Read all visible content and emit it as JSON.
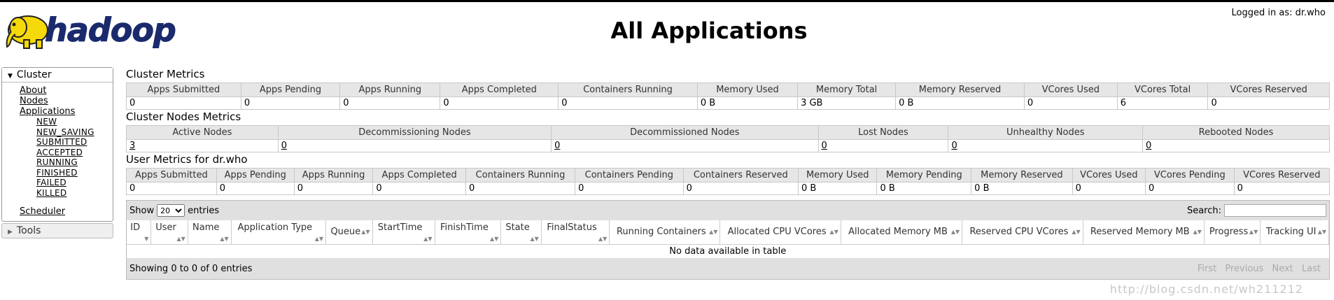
{
  "header": {
    "logo_text": "hadoop",
    "title": "All Applications",
    "logged_in": "Logged in as: dr.who"
  },
  "sidebar": {
    "cluster_label": "Cluster",
    "items": [
      "About",
      "Nodes",
      "Applications"
    ],
    "app_states": [
      "NEW",
      "NEW_SAVING",
      "SUBMITTED",
      "ACCEPTED",
      "RUNNING",
      "FINISHED",
      "FAILED",
      "KILLED"
    ],
    "scheduler": "Scheduler",
    "tools_label": "Tools"
  },
  "cluster_metrics": {
    "title": "Cluster Metrics",
    "headers": [
      "Apps Submitted",
      "Apps Pending",
      "Apps Running",
      "Apps Completed",
      "Containers Running",
      "Memory Used",
      "Memory Total",
      "Memory Reserved",
      "VCores Used",
      "VCores Total",
      "VCores Reserved"
    ],
    "values": [
      "0",
      "0",
      "0",
      "0",
      "0",
      "0 B",
      "3 GB",
      "0 B",
      "0",
      "6",
      "0"
    ]
  },
  "node_metrics": {
    "title": "Cluster Nodes Metrics",
    "headers": [
      "Active Nodes",
      "Decommissioning Nodes",
      "Decommissioned Nodes",
      "Lost Nodes",
      "Unhealthy Nodes",
      "Rebooted Nodes"
    ],
    "values": [
      "3",
      "0",
      "0",
      "0",
      "0",
      "0"
    ]
  },
  "user_metrics": {
    "title": "User Metrics for dr.who",
    "headers": [
      "Apps Submitted",
      "Apps Pending",
      "Apps Running",
      "Apps Completed",
      "Containers Running",
      "Containers Pending",
      "Containers Reserved",
      "Memory Used",
      "Memory Pending",
      "Memory Reserved",
      "VCores Used",
      "VCores Pending",
      "VCores Reserved"
    ],
    "values": [
      "0",
      "0",
      "0",
      "0",
      "0",
      "0",
      "0",
      "0 B",
      "0 B",
      "0 B",
      "0",
      "0",
      "0"
    ]
  },
  "apps_table": {
    "show_label": "Show",
    "page_size": "20",
    "entries_label": "entries",
    "search_label": "Search:",
    "columns": [
      {
        "label": "ID",
        "two": true
      },
      {
        "label": "User",
        "two": true
      },
      {
        "label": "Name",
        "two": true
      },
      {
        "label": "Application Type",
        "two": true
      },
      {
        "label": "Queue",
        "two": false
      },
      {
        "label": "StartTime",
        "two": true
      },
      {
        "label": "FinishTime",
        "two": true
      },
      {
        "label": "State",
        "two": true
      },
      {
        "label": "FinalStatus",
        "two": true
      },
      {
        "label": "Running Containers",
        "two": false
      },
      {
        "label": "Allocated CPU VCores",
        "two": false
      },
      {
        "label": "Allocated Memory MB",
        "two": false
      },
      {
        "label": "Reserved CPU VCores",
        "two": false
      },
      {
        "label": "Reserved Memory MB",
        "two": false
      },
      {
        "label": "Progress",
        "two": false
      },
      {
        "label": "Tracking UI",
        "two": false
      }
    ],
    "empty_message": "No data available in table",
    "footer_info": "Showing 0 to 0 of 0 entries",
    "pager": [
      "First",
      "Previous",
      "Next",
      "Last"
    ]
  },
  "watermark": "http://blog.csdn.net/wh211212"
}
